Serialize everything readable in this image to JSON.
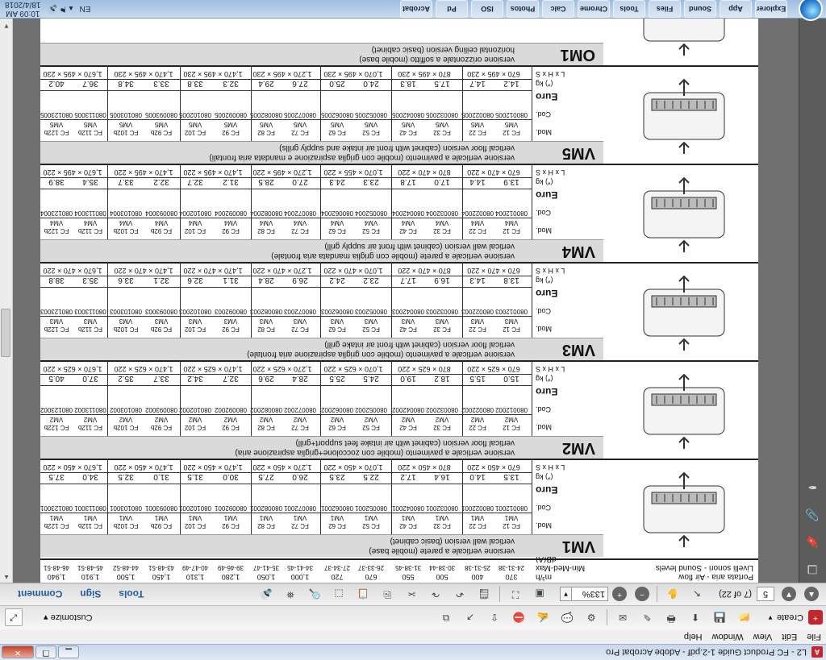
{
  "window": {
    "title": "L2 - FC Product Guide 1-2.pdf - Adobe Acrobat Pro",
    "min": "▁",
    "max": "❐",
    "close": "✕"
  },
  "menu": [
    "File",
    "Edit",
    "View",
    "Window",
    "Help"
  ],
  "toolbar1": {
    "create_label": "Create",
    "customize_label": "Customize"
  },
  "toolbar2": {
    "page_number": "5",
    "page_of": "(7 of 22)",
    "zoom": "133%"
  },
  "panel_links": [
    "Tools",
    "Sign",
    "Comment"
  ],
  "table": {
    "header_label1": "Portata aria - Air flow",
    "header_label2": "Livelli sonori - Sound levels",
    "header_unit1": "m³/h",
    "header_unit2": "Min-Med-Max dB(A)",
    "header_flows": [
      "370",
      "400",
      "500",
      "550",
      "670",
      "720",
      "1,000",
      "1,050",
      "1,280",
      "1,310",
      "1,450",
      "1,500",
      "1,910",
      "1,940"
    ],
    "header_levels": [
      "24-31-38",
      "25-31-38",
      "30-38-44",
      "31-38-45",
      "26-33-37",
      "27-34-37",
      "34-41-45",
      "35-41-47",
      "39-46-49",
      "40-47-49",
      "43-48-51",
      "44-48-52",
      "45-48-51",
      "46-48-51"
    ],
    "row_labels": {
      "mod": "Mod.",
      "cod": "Cod.",
      "euro": "Euro",
      "kg": "(*) kg",
      "dims": "L x H x S"
    },
    "models": [
      "FC 12",
      "FC 22",
      "FC 32",
      "FC 42",
      "FC 52",
      "FC 62",
      "FC 72",
      "FC 82",
      "FC 92",
      "FC 102",
      "FC 92b",
      "FC 102b",
      "FC 112b",
      "FC 122b"
    ],
    "products": [
      {
        "code": "VM1",
        "desc_it": "versione verticale a parete (mobile base)",
        "desc_en": "vertical wall version (basic cabinet)",
        "suffix": "VM1",
        "cods": [
          "080012001",
          "080022001",
          "080032001",
          "080042001",
          "080052001",
          "080062001",
          "080072001",
          "080082001",
          "080092001",
          "080102001",
          "080093001",
          "080103001",
          "080113001",
          "080123001"
        ],
        "weights": [
          "13.5",
          "14.0",
          "16.4",
          "17.2",
          "22.5",
          "23.5",
          "26.0",
          "27.5",
          "30.0",
          "31.5",
          "31.0",
          "32.5",
          "34.0",
          "37.5"
        ],
        "dims": [
          "670 × 450 × 220",
          "870 × 450 × 220",
          "1,070 × 450 × 220",
          "1,270 × 450 × 220",
          "1,470 × 450 × 220",
          "1,470 × 450 × 220",
          "1,670 × 450 × 220"
        ]
      },
      {
        "code": "VM2",
        "desc_it": "versione verticale a pavimento (mobile con zoccolone+griglia aspirazione aria)",
        "desc_en": "vertical floor version (cabinet with air intake feet support+grill)",
        "suffix": "VM2",
        "cods": [
          "080012002",
          "080022002",
          "080032002",
          "080042002",
          "080052002",
          "080062002",
          "080072002",
          "080082002",
          "080092002",
          "080102002",
          "080093002",
          "080103002",
          "080113002",
          "080123002"
        ],
        "weights": [
          "15.0",
          "15.5",
          "18.2",
          "19.0",
          "24.5",
          "25.5",
          "28.4",
          "29.6",
          "32.7",
          "34.2",
          "33.7",
          "35.2",
          "37.0",
          "40.5"
        ],
        "dims": [
          "670 × 625 × 220",
          "870 × 625 × 220",
          "1,070 × 625 × 220",
          "1,270 × 625 × 220",
          "1,470 × 625 × 220",
          "1,470 × 625 × 220",
          "1,670 × 625 × 220"
        ]
      },
      {
        "code": "VM3",
        "desc_it": "versione verticale a pavimento (mobile con griglia aspirazione aria frontale)",
        "desc_en": "vertical floor version (cabinet with front air intake grill)",
        "suffix": "VM3",
        "cods": [
          "080012003",
          "080022003",
          "080032003",
          "080042003",
          "080052003",
          "080062003",
          "080072003",
          "080082003",
          "080092003",
          "080102003",
          "080093003",
          "080103003",
          "080113003",
          "080123003"
        ],
        "weights": [
          "13.8",
          "14.3",
          "16.9",
          "17.7",
          "23.2",
          "24.2",
          "26.9",
          "28.4",
          "31.1",
          "32.6",
          "32.1",
          "33.6",
          "35.3",
          "38.8"
        ],
        "dims": [
          "670 × 470 × 220",
          "870 × 470 × 220",
          "1,070 × 470 × 220",
          "1,270 × 470 × 220",
          "1,470 × 470 × 220",
          "1,470 × 470 × 220",
          "1,670 × 470 × 220"
        ]
      },
      {
        "code": "VM4",
        "desc_it": "versione verticale a parete (mobile con griglia mandata aria frontale)",
        "desc_en": "vertical wall version (cabinet with front air supply grill)",
        "suffix": "VM4",
        "cods": [
          "080012004",
          "080022004",
          "080032004",
          "080042004",
          "080052004",
          "080062004",
          "080072004",
          "080082004",
          "080092004",
          "080102004",
          "080093004",
          "080103004",
          "080113004",
          "080123004"
        ],
        "weights": [
          "13.9",
          "14.4",
          "17.0",
          "17.8",
          "23.3",
          "24.3",
          "27.0",
          "28.5",
          "31.2",
          "32.7",
          "32.2",
          "33.7",
          "35.4",
          "38.9"
        ],
        "dims": [
          "670 × 470 × 220",
          "870 × 470 × 220",
          "1,070 × 455 × 220",
          "1,270 × 495 × 220",
          "1,470 × 495 × 220",
          "1,470 × 495 × 220",
          "1,670 × 495 × 220"
        ]
      },
      {
        "code": "VM5",
        "desc_it": "versione verticale a pavimento (mobile con griglia aspirazione e mandata aria frontali)",
        "desc_en": "vertical floor version (cabinet with front air intake and supply grills)",
        "suffix": "VM5",
        "cods": [
          "080012005",
          "080022005",
          "080032005",
          "080042005",
          "080052005",
          "080062005",
          "080072005",
          "080082005",
          "080092005",
          "080102005",
          "080093005",
          "080103005",
          "080113005",
          "080123005"
        ],
        "weights": [
          "14.2",
          "14.7",
          "17.5",
          "18.3",
          "24.0",
          "25.0",
          "27.6",
          "29.4",
          "32.3",
          "33.8",
          "33.3",
          "34.8",
          "36.7",
          "40.2"
        ],
        "dims": [
          "670 × 495 × 230",
          "870 × 495 × 230",
          "1,070 × 495 × 230",
          "1,270 × 495 × 230",
          "1,470 × 495 × 230",
          "1,470 × 495 × 230",
          "1,670 × 495 × 230"
        ]
      },
      {
        "code": "OM1",
        "desc_it": "versione orizzontale a soffitto (mobile base)",
        "desc_en": "horizontal ceiling version (basic cabinet)",
        "suffix": "OM1",
        "cods": [],
        "weights": [],
        "dims": []
      }
    ]
  },
  "taskbar": {
    "apps": [
      "Explorer",
      "App",
      "Sound",
      "Files",
      "Tools",
      "Chrome",
      "Calc",
      "Photos",
      "ISO",
      "Pd",
      "Acrobat"
    ],
    "lang": "EN",
    "time": "10:09 AM",
    "date": "18/4/2018"
  }
}
